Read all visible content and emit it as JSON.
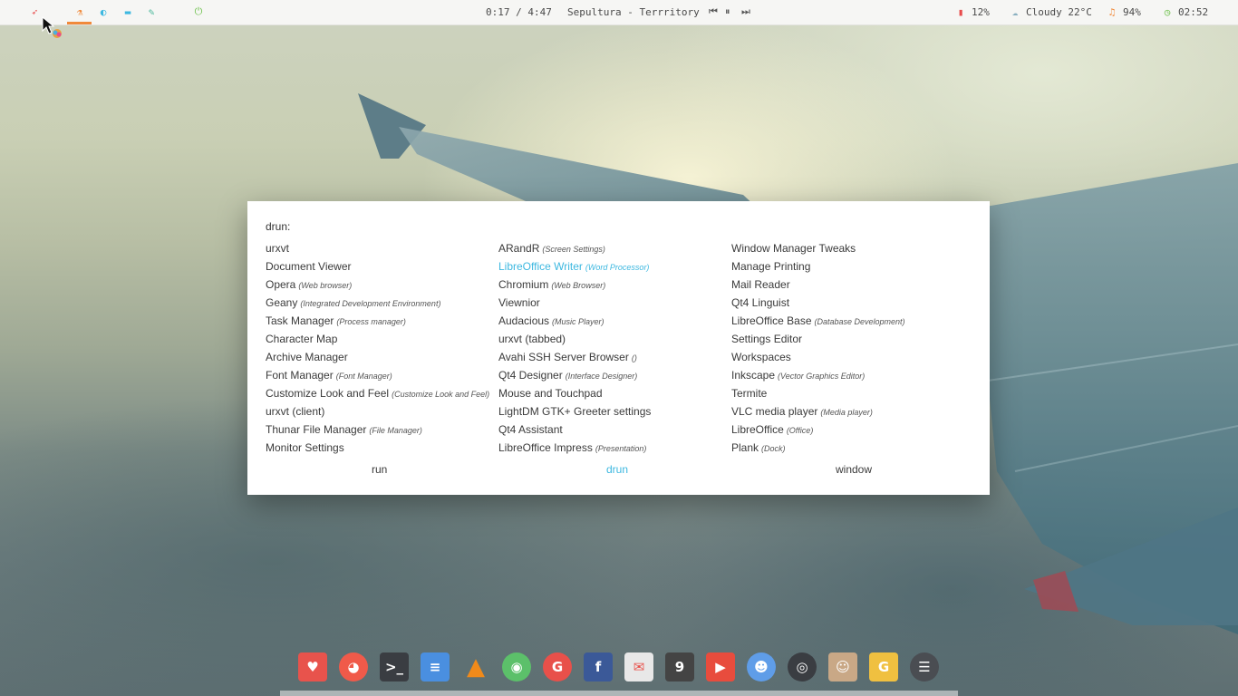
{
  "topbar": {
    "left_icons": [
      "rocket-icon",
      "flask-icon",
      "moon-icon",
      "folder-icon",
      "pencil-icon",
      "power-icon"
    ],
    "media": {
      "time": "0:17 / 4:47",
      "track": "Sepultura - Terrritory"
    },
    "status": {
      "cpu": "12%",
      "weather": "Cloudy 22°C",
      "volume": "94%",
      "clock": "02:52"
    }
  },
  "launcher": {
    "prompt": "drun:",
    "columns": [
      [
        {
          "name": "urxvt",
          "desc": ""
        },
        {
          "name": "Document Viewer",
          "desc": ""
        },
        {
          "name": "Opera",
          "desc": "(Web browser)"
        },
        {
          "name": "Geany",
          "desc": "(Integrated Development Environment)"
        },
        {
          "name": "Task Manager",
          "desc": "(Process manager)"
        },
        {
          "name": "Character Map",
          "desc": ""
        },
        {
          "name": "Archive Manager",
          "desc": ""
        },
        {
          "name": "Font Manager",
          "desc": "(Font Manager)"
        },
        {
          "name": "Customize Look and Feel",
          "desc": "(Customize Look and Feel)"
        },
        {
          "name": "urxvt (client)",
          "desc": ""
        },
        {
          "name": "Thunar File Manager",
          "desc": "(File Manager)"
        },
        {
          "name": "Monitor Settings",
          "desc": ""
        }
      ],
      [
        {
          "name": "ARandR",
          "desc": "(Screen Settings)"
        },
        {
          "name": "LibreOffice Writer",
          "desc": "(Word Processor)"
        },
        {
          "name": "Chromium",
          "desc": "(Web Browser)"
        },
        {
          "name": "Viewnior",
          "desc": ""
        },
        {
          "name": "Audacious",
          "desc": "(Music Player)"
        },
        {
          "name": "urxvt (tabbed)",
          "desc": ""
        },
        {
          "name": "Avahi SSH Server Browser",
          "desc": "()"
        },
        {
          "name": "Qt4 Designer",
          "desc": "(Interface Designer)"
        },
        {
          "name": "Mouse and Touchpad",
          "desc": ""
        },
        {
          "name": "LightDM GTK+ Greeter settings",
          "desc": ""
        },
        {
          "name": "Qt4 Assistant",
          "desc": ""
        },
        {
          "name": "LibreOffice Impress",
          "desc": "(Presentation)"
        }
      ],
      [
        {
          "name": "Window Manager Tweaks",
          "desc": ""
        },
        {
          "name": "Manage Printing",
          "desc": ""
        },
        {
          "name": "Mail Reader",
          "desc": ""
        },
        {
          "name": "Qt4 Linguist",
          "desc": ""
        },
        {
          "name": "LibreOffice Base",
          "desc": "(Database Development)"
        },
        {
          "name": "Settings Editor",
          "desc": ""
        },
        {
          "name": "Workspaces",
          "desc": ""
        },
        {
          "name": "Inkscape",
          "desc": "(Vector Graphics Editor)"
        },
        {
          "name": "Termite",
          "desc": ""
        },
        {
          "name": "VLC media player",
          "desc": "(Media player)"
        },
        {
          "name": "LibreOffice",
          "desc": "(Office)"
        },
        {
          "name": "Plank",
          "desc": "(Dock)"
        }
      ]
    ],
    "modes": [
      "run",
      "drun",
      "window"
    ],
    "active_mode": "drun",
    "selected_item": "LibreOffice Writer",
    "accent_color": "#3db8e0"
  },
  "dock": {
    "apps": [
      {
        "name": "files-icon",
        "color": "#e8534c"
      },
      {
        "name": "firefox-icon",
        "color": "#f05a4a"
      },
      {
        "name": "terminal-icon",
        "color": "#3a3d42"
      },
      {
        "name": "notes-icon",
        "color": "#4a8fe0"
      },
      {
        "name": "vlc-icon",
        "color": "#f08a1a"
      },
      {
        "name": "podcast-icon",
        "color": "#5cc06a"
      },
      {
        "name": "google-plus-icon",
        "color": "#e8504a"
      },
      {
        "name": "facebook-icon",
        "color": "#3b5998"
      },
      {
        "name": "gmail-icon",
        "color": "#e8e8e8"
      },
      {
        "name": "nine-icon",
        "color": "#444444"
      },
      {
        "name": "youtube-icon",
        "color": "#e84c3d"
      },
      {
        "name": "reddit-icon",
        "color": "#5f9de8"
      },
      {
        "name": "github-icon",
        "color": "#3a3d42"
      },
      {
        "name": "avatar-icon",
        "color": "#c9a886"
      },
      {
        "name": "guitar-pick-icon",
        "color": "#f0c040"
      },
      {
        "name": "settings-icon",
        "color": "#4a4d52"
      }
    ]
  },
  "colors": {
    "accent_orange": "#f0893a",
    "topbar_bg": "#f6f6f4"
  }
}
